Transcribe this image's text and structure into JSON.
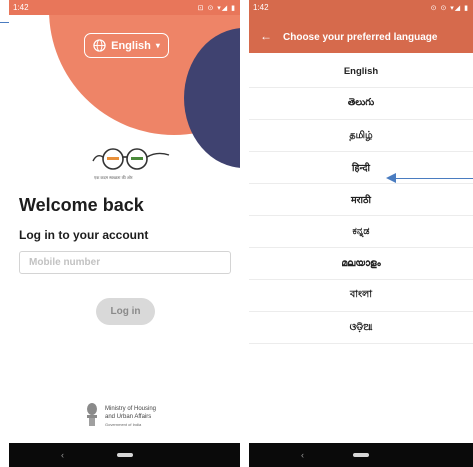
{
  "left_screen": {
    "status": {
      "time": "1:42",
      "icons": "⊡ ⊙ ▾◢ ▮"
    },
    "language_selector": {
      "label": "English",
      "caret": "▾"
    },
    "logo_tagline": "एक कदम स्वच्छता की ओर",
    "welcome_title": "Welcome back",
    "login_subtitle": "Log in to your account",
    "mobile_placeholder": "Mobile number",
    "login_button": "Log in",
    "footer": {
      "line1": "Ministry of Housing",
      "line2": "and Urban Affairs",
      "line3": "Government of India"
    },
    "nav": {
      "back": "‹"
    }
  },
  "right_screen": {
    "status": {
      "time": "1:42",
      "icons": "⊙ ⊙ ▾◢ ▮"
    },
    "back_arrow": "←",
    "title": "Choose your preferred language",
    "languages": [
      "English",
      "తెలుగు",
      "தமிழ்",
      "हिन्दी",
      "मराठी",
      "ಕನ್ನಡ",
      "മലയാളം",
      "বাংলা",
      "ଓଡ଼ିଆ"
    ],
    "nav": {
      "back": "‹"
    }
  },
  "colors": {
    "salmon": "#ee8467",
    "navy": "#3f4270",
    "appbar": "#d66a4c",
    "arrow": "#4a7cc0"
  }
}
